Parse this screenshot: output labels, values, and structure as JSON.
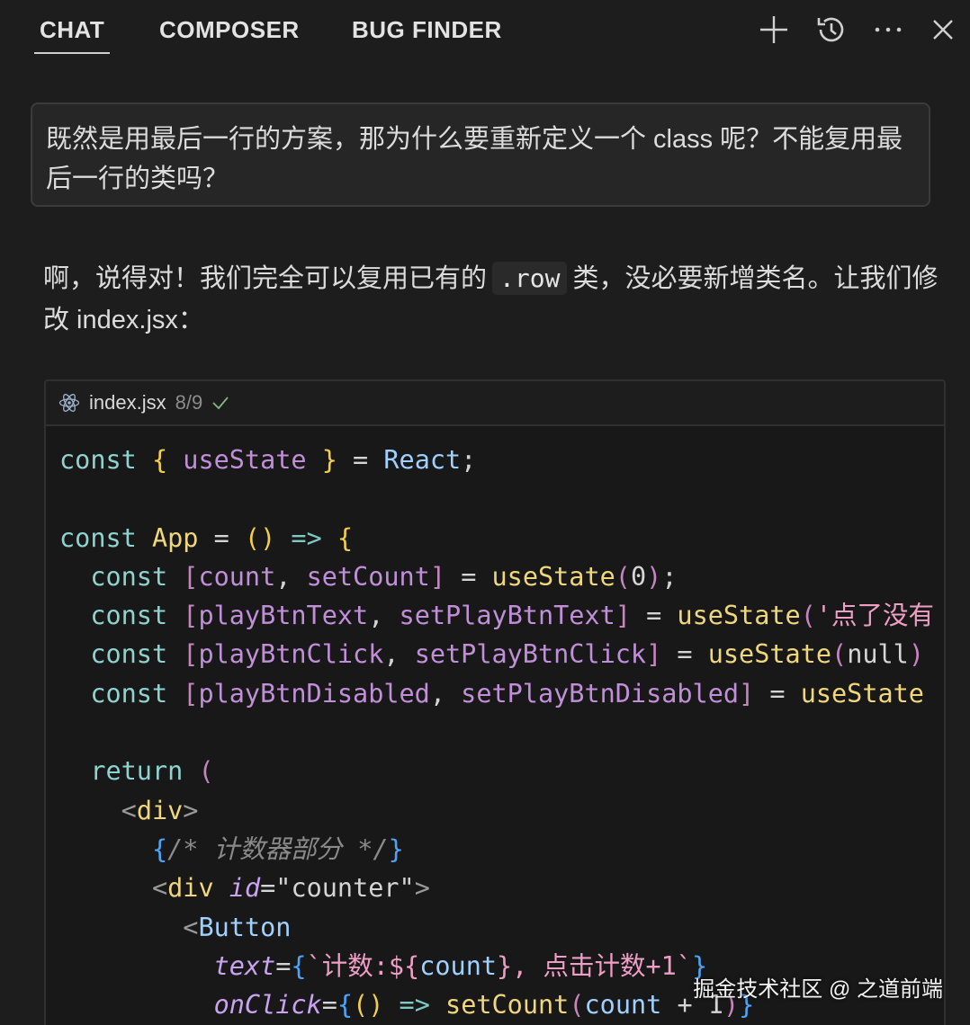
{
  "header": {
    "tabs": [
      {
        "label": "CHAT",
        "active": true
      },
      {
        "label": "COMPOSER",
        "active": false
      },
      {
        "label": "BUG FINDER",
        "active": false
      }
    ],
    "icons": [
      "plus-icon",
      "history-icon",
      "more-icon",
      "close-icon"
    ]
  },
  "user_message": {
    "text": "既然是用最后一行的方案，那为什么要重新定义一个 class 呢？不能复用最后一行的类吗？"
  },
  "answer": {
    "part1": "啊，说得对！我们完全可以复用已有的",
    "code": ".row",
    "part2": "类，没必要新增类名。让我们修改 index.jsx："
  },
  "code_block": {
    "filename": "index.jsx",
    "progress": "8/9",
    "status_icon": "check-icon",
    "lines": [
      [
        [
          "t-kw",
          "const "
        ],
        [
          "t-brace",
          "{ "
        ],
        [
          "t-var",
          "useState "
        ],
        [
          "t-brace",
          "}"
        ],
        [
          "t-plain",
          " = "
        ],
        [
          "t-name",
          "React"
        ],
        [
          "t-plain",
          ";"
        ]
      ],
      [],
      [
        [
          "t-kw",
          "const "
        ],
        [
          "t-fn",
          "App"
        ],
        [
          "t-plain",
          " = "
        ],
        [
          "t-brace",
          "()"
        ],
        [
          "t-plain",
          " "
        ],
        [
          "t-kw2",
          "=>"
        ],
        [
          "t-plain",
          " "
        ],
        [
          "t-brace",
          "{"
        ]
      ],
      [
        [
          "t-plain",
          "  "
        ],
        [
          "t-kw",
          "const "
        ],
        [
          "t-brack",
          "["
        ],
        [
          "t-var",
          "count"
        ],
        [
          "t-plain",
          ", "
        ],
        [
          "t-var",
          "setCount"
        ],
        [
          "t-brack",
          "]"
        ],
        [
          "t-plain",
          " = "
        ],
        [
          "t-fn",
          "useState"
        ],
        [
          "t-brack",
          "("
        ],
        [
          "t-num",
          "0"
        ],
        [
          "t-brack",
          ")"
        ],
        [
          "t-plain",
          ";"
        ]
      ],
      [
        [
          "t-plain",
          "  "
        ],
        [
          "t-kw",
          "const "
        ],
        [
          "t-brack",
          "["
        ],
        [
          "t-var",
          "playBtnText"
        ],
        [
          "t-plain",
          ", "
        ],
        [
          "t-var",
          "setPlayBtnText"
        ],
        [
          "t-brack",
          "]"
        ],
        [
          "t-plain",
          " = "
        ],
        [
          "t-fn",
          "useState"
        ],
        [
          "t-brack",
          "("
        ],
        [
          "t-str",
          "'点了没有"
        ]
      ],
      [
        [
          "t-plain",
          "  "
        ],
        [
          "t-kw",
          "const "
        ],
        [
          "t-brack",
          "["
        ],
        [
          "t-var",
          "playBtnClick"
        ],
        [
          "t-plain",
          ", "
        ],
        [
          "t-var",
          "setPlayBtnClick"
        ],
        [
          "t-brack",
          "]"
        ],
        [
          "t-plain",
          " = "
        ],
        [
          "t-fn",
          "useState"
        ],
        [
          "t-brack",
          "("
        ],
        [
          "t-num",
          "null"
        ],
        [
          "t-brack",
          ")"
        ]
      ],
      [
        [
          "t-plain",
          "  "
        ],
        [
          "t-kw",
          "const "
        ],
        [
          "t-brack",
          "["
        ],
        [
          "t-var",
          "playBtnDisabled"
        ],
        [
          "t-plain",
          ", "
        ],
        [
          "t-var",
          "setPlayBtnDisabled"
        ],
        [
          "t-brack",
          "]"
        ],
        [
          "t-plain",
          " = "
        ],
        [
          "t-fn",
          "useState"
        ]
      ],
      [],
      [
        [
          "t-plain",
          "  "
        ],
        [
          "t-kw",
          "return "
        ],
        [
          "t-brack",
          "("
        ]
      ],
      [
        [
          "t-plain",
          "    "
        ],
        [
          "t-punct",
          "<"
        ],
        [
          "t-tag",
          "div"
        ],
        [
          "t-punct",
          ">"
        ]
      ],
      [
        [
          "t-plain",
          "      "
        ],
        [
          "t-jsxbrace",
          "{"
        ],
        [
          "t-comment",
          "/* 计数器部分 */"
        ],
        [
          "t-jsxbrace",
          "}"
        ]
      ],
      [
        [
          "t-plain",
          "      "
        ],
        [
          "t-punct",
          "<"
        ],
        [
          "t-tag",
          "div"
        ],
        [
          "t-plain",
          " "
        ],
        [
          "t-attr",
          "id"
        ],
        [
          "t-plain",
          "="
        ],
        [
          "t-plain",
          "\"counter\""
        ],
        [
          "t-punct",
          ">"
        ]
      ],
      [
        [
          "t-plain",
          "        "
        ],
        [
          "t-punct",
          "<"
        ],
        [
          "t-name",
          "Button"
        ]
      ],
      [
        [
          "t-plain",
          "          "
        ],
        [
          "t-attr",
          "text"
        ],
        [
          "t-plain",
          "="
        ],
        [
          "t-jsxbrace",
          "{"
        ],
        [
          "t-tpl",
          "`计数:${"
        ],
        [
          "t-name",
          "count"
        ],
        [
          "t-tpl",
          "}, 点击计数+1`"
        ],
        [
          "t-jsxbrace",
          "}"
        ]
      ],
      [
        [
          "t-plain",
          "          "
        ],
        [
          "t-attr",
          "onClick"
        ],
        [
          "t-plain",
          "="
        ],
        [
          "t-jsxbrace",
          "{"
        ],
        [
          "t-brace",
          "()"
        ],
        [
          "t-plain",
          " "
        ],
        [
          "t-kw2",
          "=>"
        ],
        [
          "t-plain",
          " "
        ],
        [
          "t-fn",
          "setCount"
        ],
        [
          "t-brack",
          "("
        ],
        [
          "t-name",
          "count"
        ],
        [
          "t-plain",
          " + 1"
        ],
        [
          "t-brack",
          ")"
        ],
        [
          "t-jsxbrace",
          "}"
        ]
      ]
    ]
  },
  "watermark": "掘金技术社区 @ 之道前端"
}
